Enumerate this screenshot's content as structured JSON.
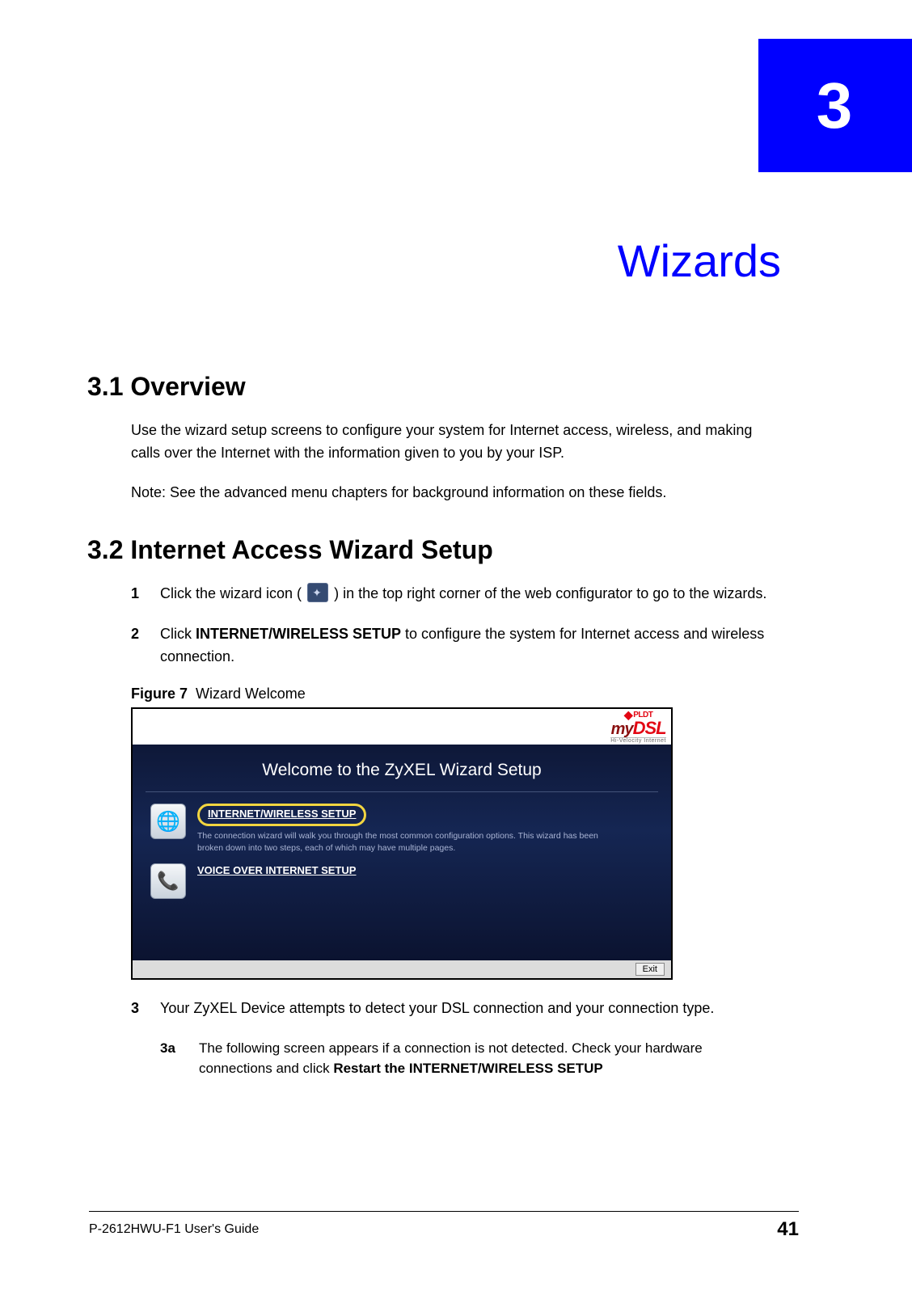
{
  "chapter": {
    "number": "3",
    "title": "Wizards"
  },
  "section1": {
    "heading": "3.1  Overview",
    "para": "Use the wizard setup screens to configure your system for Internet access, wireless, and making calls over the Internet with the information given to you by your ISP.",
    "note": "Note: See the advanced menu chapters for background information on these fields."
  },
  "section2": {
    "heading": "3.2  Internet Access Wizard Setup",
    "steps": {
      "s1_num": "1",
      "s1_a": "Click the wizard icon (",
      "s1_b": ") in the top right corner of the web configurator to go to the wizards.",
      "s2_num": "2",
      "s2_a": "Click ",
      "s2_bold": "INTERNET/WIRELESS SETUP",
      "s2_b": " to configure the system for Internet access and wireless connection.",
      "s3_num": "3",
      "s3_text": "Your ZyXEL Device attempts to detect your DSL connection and your connection type.",
      "s3a_num": "3a",
      "s3a_a": "The following screen appears if a connection is not detected. Check your hardware connections and click ",
      "s3a_bold": "Restart the INTERNET/WIRELESS SETUP"
    }
  },
  "figure": {
    "label": "Figure 7",
    "title": "Wizard Welcome",
    "logo_brand_top": "PLDT",
    "logo_my": "my",
    "logo_dsl": "DSL",
    "logo_sub": "Hi-Velocity Internet",
    "welcome": "Welcome to the ZyXEL Wizard Setup",
    "link1": "INTERNET/WIRELESS SETUP",
    "desc1": "The connection wizard will walk you through the most common configuration options. This wizard has been broken down into two steps, each of which may have multiple pages.",
    "link2": "VOICE OVER INTERNET SETUP",
    "exit": "Exit"
  },
  "footer": {
    "guide": "P-2612HWU-F1 User's Guide",
    "page": "41"
  }
}
